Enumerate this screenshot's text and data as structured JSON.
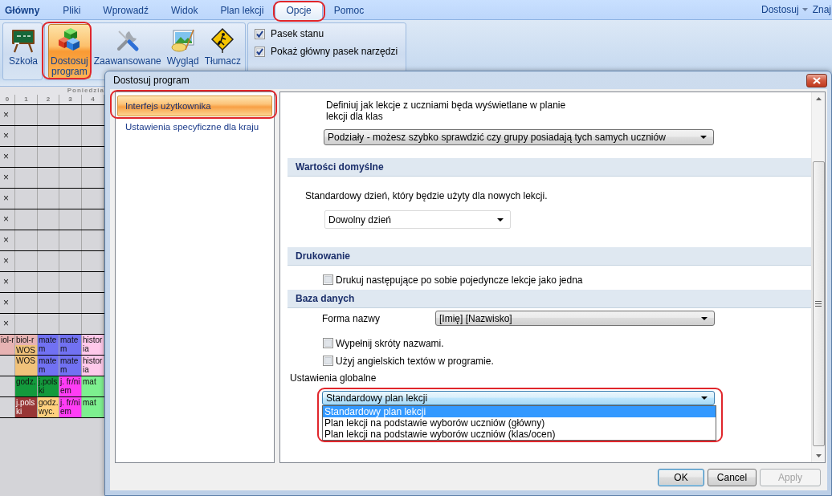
{
  "ribbon": {
    "app_button": {
      "label": "Główny"
    },
    "tabs": [
      {
        "label": "Pliki",
        "selected": false,
        "circled": false
      },
      {
        "label": "Wprowadź",
        "selected": false,
        "circled": false
      },
      {
        "label": "Widok",
        "selected": false,
        "circled": false
      },
      {
        "label": "Plan lekcji",
        "selected": false,
        "circled": false
      },
      {
        "label": "Opcje",
        "selected": true,
        "circled": true
      },
      {
        "label": "Pomoc",
        "selected": false,
        "circled": false
      }
    ],
    "customize_menu": {
      "label": "Dostosuj"
    },
    "help_link": {
      "label": "Znaj"
    },
    "groups": [
      {
        "buttons": [
          {
            "label": "Szkoła",
            "selected": false,
            "circled": false
          }
        ]
      },
      {
        "buttons": [
          {
            "label": "Dostosuj program",
            "selected": true,
            "circled": true
          },
          {
            "label": "Zaawansowane",
            "selected": false,
            "circled": false
          },
          {
            "label": "Wygląd",
            "selected": false,
            "circled": false
          },
          {
            "label": "Tłumacz",
            "selected": false,
            "circled": false
          }
        ]
      }
    ],
    "options": [
      {
        "label": "Pasek stanu",
        "checked": true
      },
      {
        "label": "Pokaż główny pasek narzędzi",
        "checked": true
      }
    ]
  },
  "timetable": {
    "day": "Poniedzia",
    "columns": [
      "0",
      "1",
      "2",
      "3",
      "4"
    ],
    "rows": [
      {
        "cells": [
          {
            "kind": "mark",
            "text": "×"
          },
          {
            "kind": "empty"
          },
          {
            "kind": "empty"
          },
          {
            "kind": "empty"
          },
          {
            "kind": "empty"
          }
        ]
      },
      {
        "cells": [
          {
            "kind": "mark",
            "text": "×"
          },
          {
            "kind": "empty"
          },
          {
            "kind": "empty"
          },
          {
            "kind": "empty"
          },
          {
            "kind": "empty"
          }
        ]
      },
      {
        "cells": [
          {
            "kind": "mark",
            "text": "×"
          },
          {
            "kind": "empty"
          },
          {
            "kind": "empty"
          },
          {
            "kind": "empty"
          },
          {
            "kind": "empty"
          }
        ]
      },
      {
        "cells": [
          {
            "kind": "mark",
            "text": "×"
          },
          {
            "kind": "empty"
          },
          {
            "kind": "empty"
          },
          {
            "kind": "empty"
          },
          {
            "kind": "empty"
          }
        ]
      },
      {
        "cells": [
          {
            "kind": "mark",
            "text": "×"
          },
          {
            "kind": "empty"
          },
          {
            "kind": "empty"
          },
          {
            "kind": "empty"
          },
          {
            "kind": "empty"
          }
        ]
      },
      {
        "cells": [
          {
            "kind": "mark",
            "text": "×"
          },
          {
            "kind": "empty"
          },
          {
            "kind": "empty"
          },
          {
            "kind": "empty"
          },
          {
            "kind": "empty"
          }
        ]
      },
      {
        "cells": [
          {
            "kind": "mark",
            "text": "×"
          },
          {
            "kind": "empty"
          },
          {
            "kind": "empty"
          },
          {
            "kind": "empty"
          },
          {
            "kind": "empty"
          }
        ]
      },
      {
        "cells": [
          {
            "kind": "mark",
            "text": "×"
          },
          {
            "kind": "empty"
          },
          {
            "kind": "empty"
          },
          {
            "kind": "empty"
          },
          {
            "kind": "empty"
          }
        ]
      },
      {
        "cells": [
          {
            "kind": "mark",
            "text": "×"
          },
          {
            "kind": "empty"
          },
          {
            "kind": "empty"
          },
          {
            "kind": "empty"
          },
          {
            "kind": "empty"
          }
        ]
      },
      {
        "cells": [
          {
            "kind": "mark",
            "text": "×"
          },
          {
            "kind": "empty"
          },
          {
            "kind": "empty"
          },
          {
            "kind": "empty"
          },
          {
            "kind": "empty"
          }
        ]
      },
      {
        "cells": [
          {
            "kind": "mark",
            "text": "×"
          },
          {
            "kind": "empty"
          },
          {
            "kind": "empty"
          },
          {
            "kind": "empty"
          },
          {
            "kind": "empty"
          }
        ]
      },
      {
        "cells": [
          {
            "kind": "lesson",
            "lessons": [
              {
                "text": "iol-r",
                "color": "#e7b3b3"
              }
            ]
          },
          {
            "kind": "lesson",
            "lessons": [
              {
                "text": "biol-r",
                "color": "#e7b3b3"
              },
              {
                "text": "WOS",
                "color": "#f0c27a"
              }
            ]
          },
          {
            "kind": "lesson",
            "lessons": [
              {
                "text": "matem",
                "color": "#7171f2"
              }
            ]
          },
          {
            "kind": "lesson",
            "lessons": [
              {
                "text": "matem",
                "color": "#7171f2"
              }
            ]
          },
          {
            "kind": "lesson",
            "lessons": [
              {
                "text": "historia",
                "color": "#ffc9ea"
              }
            ]
          }
        ]
      },
      {
        "cells": [
          {
            "kind": "empty"
          },
          {
            "kind": "lesson",
            "lessons": [
              {
                "text": "WOS",
                "color": "#f0c27a"
              }
            ]
          },
          {
            "kind": "lesson",
            "lessons": [
              {
                "text": "matem",
                "color": "#7171f2"
              }
            ]
          },
          {
            "kind": "lesson",
            "lessons": [
              {
                "text": "matem",
                "color": "#7171f2"
              }
            ]
          },
          {
            "kind": "lesson",
            "lessons": [
              {
                "text": "historia",
                "color": "#ffc9ea"
              }
            ]
          }
        ]
      },
      {
        "cells": [
          {
            "kind": "empty"
          },
          {
            "kind": "lesson",
            "lessons": [
              {
                "text": "godz.",
                "color": "#139a3c"
              }
            ]
          },
          {
            "kind": "lesson",
            "lessons": [
              {
                "text": "j.polski",
                "color": "#139a3c"
              }
            ]
          },
          {
            "kind": "lesson",
            "lessons": [
              {
                "text": "j. fr/niem",
                "color": "#ff3df5"
              }
            ]
          },
          {
            "kind": "lesson",
            "lessons": [
              {
                "text": "mat",
                "color": "#7df08f"
              }
            ]
          }
        ]
      },
      {
        "cells": [
          {
            "kind": "empty"
          },
          {
            "kind": "lesson",
            "lessons": [
              {
                "text": "j.polski",
                "color": "#983636"
              }
            ]
          },
          {
            "kind": "lesson",
            "lessons": [
              {
                "text": "godz. wyc.",
                "color": "#ffd07e"
              }
            ]
          },
          {
            "kind": "lesson",
            "lessons": [
              {
                "text": "j. fr/niem",
                "color": "#ff3df5"
              }
            ]
          },
          {
            "kind": "lesson",
            "lessons": [
              {
                "text": "mat",
                "color": "#7df08f"
              }
            ]
          }
        ]
      }
    ]
  },
  "dialog": {
    "title": "Dostosuj program",
    "nav": [
      {
        "label": "Interfejs użytkownika",
        "selected": true,
        "circled": true
      },
      {
        "label": "Ustawienia specyficzne dla kraju",
        "selected": false,
        "circled": false
      }
    ],
    "settings": [
      {
        "kind": "description",
        "text": "Definiuj jak lekcje z uczniami będa wyświetlane w planie lekcji dla klas"
      },
      {
        "kind": "select",
        "value": "Podziały - możesz szybko sprawdzić czy grupy posiadają tych samych uczniów",
        "focused": false
      },
      {
        "kind": "section",
        "title": "Wartości domyślne"
      },
      {
        "kind": "text",
        "text": "Standardowy dzień, który będzie użyty dla nowych lekcji."
      },
      {
        "kind": "flat-select",
        "value": "Dowolny dzień",
        "focused": false
      },
      {
        "kind": "section",
        "title": "Drukowanie"
      },
      {
        "kind": "checkbox",
        "label": "Drukuj następujące po sobie pojedyncze lekcje jako jedna",
        "checked": false
      },
      {
        "kind": "section",
        "title": "Baza danych"
      },
      {
        "kind": "labeled-select",
        "label": "Forma nazwy",
        "value": "[Imię] [Nazwisko]",
        "focused": false
      },
      {
        "kind": "checkbox",
        "label": "Wypełnij skróty nazwami.",
        "checked": false
      },
      {
        "kind": "checkbox",
        "label": "Użyj angielskich textów w programie.",
        "checked": false
      },
      {
        "kind": "label",
        "text": "Ustawienia globalne"
      },
      {
        "kind": "select",
        "value": "Standardowy plan lekcji",
        "focused": true,
        "expanded": true,
        "circled": true,
        "options": [
          {
            "label": "Standardowy plan lekcji",
            "selected": true
          },
          {
            "label": "Plan lekcji na podstawie wyborów uczniów (główny)",
            "selected": false
          },
          {
            "label": "Plan lekcji na podstawie wyborów uczniów (klas/ocen)",
            "selected": false
          }
        ]
      }
    ],
    "buttons": [
      {
        "label": "OK",
        "default": true,
        "disabled": false
      },
      {
        "label": "Cancel",
        "default": false,
        "disabled": false
      },
      {
        "label": "Apply",
        "default": false,
        "disabled": true
      }
    ]
  }
}
